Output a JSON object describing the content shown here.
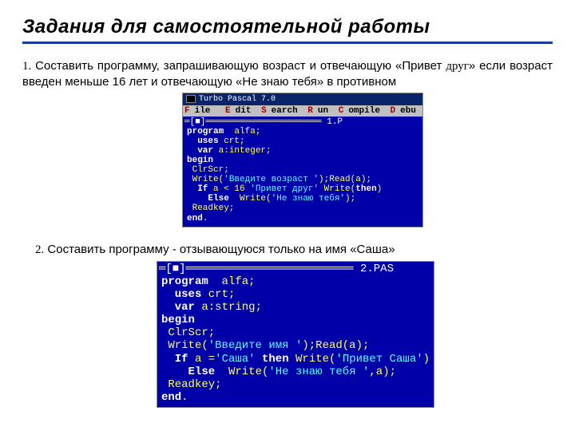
{
  "title": "Задания для самостоятельной работы",
  "task1": {
    "num": "1.",
    "text_a": " Составить   программу,   запрашивающую   возраст и   отвечающую  «Привет ",
    "serif": "друг",
    "text_b": "»  если  возраст  введен  меньше  16  лет  и  отвечающую  «Не  знаю  тебя»  в  противном"
  },
  "task2": {
    "num": "2.",
    "text": " Составить  программу -  отзывающуюся только  на  имя «Саша»"
  },
  "ide1": {
    "titlebar_icon_label": "cmd-icon",
    "title": " Turbo Pascal 7.0",
    "menu": {
      "file": "File",
      "edit": "Edit",
      "search": "Search",
      "run": "Run",
      "compile": "Compile",
      "debug": "Debu"
    },
    "frame_top": "═[■]══════════════════════ 1.P",
    "code_lines": [
      {
        "kw": "program",
        "rest": "  alfa;"
      },
      {
        "indent": "  ",
        "kw": "uses",
        "rest": " crt;"
      },
      {
        "indent": "  ",
        "kw": "var",
        "rest": " a:integer;"
      },
      {
        "kw": "begin",
        "rest": ""
      },
      {
        "indent": " ",
        "plain": "ClrScr;"
      },
      {
        "indent": " ",
        "plain": "Write(",
        "str": "'Введите возраст '",
        "plain2": ");Read(a);"
      },
      {
        "indent": "  ",
        "kw": "If",
        "plain": " a < 16 ",
        "kw2": "then",
        "plain2": " Write(",
        "str": "'Привет друг'",
        "plain3": ")"
      },
      {
        "indent": "    ",
        "kw": "Else",
        "plain": "  Write(",
        "str": "'Не знаю тебя'",
        "plain2": ");"
      },
      {
        "indent": " ",
        "plain": "Readkey;"
      },
      {
        "kw": "end",
        "rest": "."
      }
    ]
  },
  "ide2": {
    "frame_top": "═[■]═════════════════════════ 2.PAS",
    "code_lines": [
      {
        "kw": "program",
        "rest": "  alfa;"
      },
      {
        "indent": "  ",
        "kw": "uses",
        "rest": " crt;"
      },
      {
        "indent": "  ",
        "kw": "var",
        "rest": " a:string;"
      },
      {
        "kw": "begin",
        "rest": ""
      },
      {
        "indent": " ",
        "plain": "ClrScr;"
      },
      {
        "indent": " ",
        "plain": "Write(",
        "str": "'Введите имя '",
        "plain2": ");Read(a);"
      },
      {
        "indent": "  ",
        "kw": "If",
        "plain": " a =",
        "str": "'Саша'",
        "plain2": " ",
        "kw2": "then",
        "plain3": " Write(",
        "str2": "'Привет Саша'",
        "plain4": ")"
      },
      {
        "indent": "    ",
        "kw": "Else",
        "plain": "  Write(",
        "str": "'Не знаю тебя '",
        "plain2": ",a);"
      },
      {
        "indent": " ",
        "plain": "Readkey;"
      },
      {
        "kw": "end",
        "rest": "."
      }
    ]
  }
}
